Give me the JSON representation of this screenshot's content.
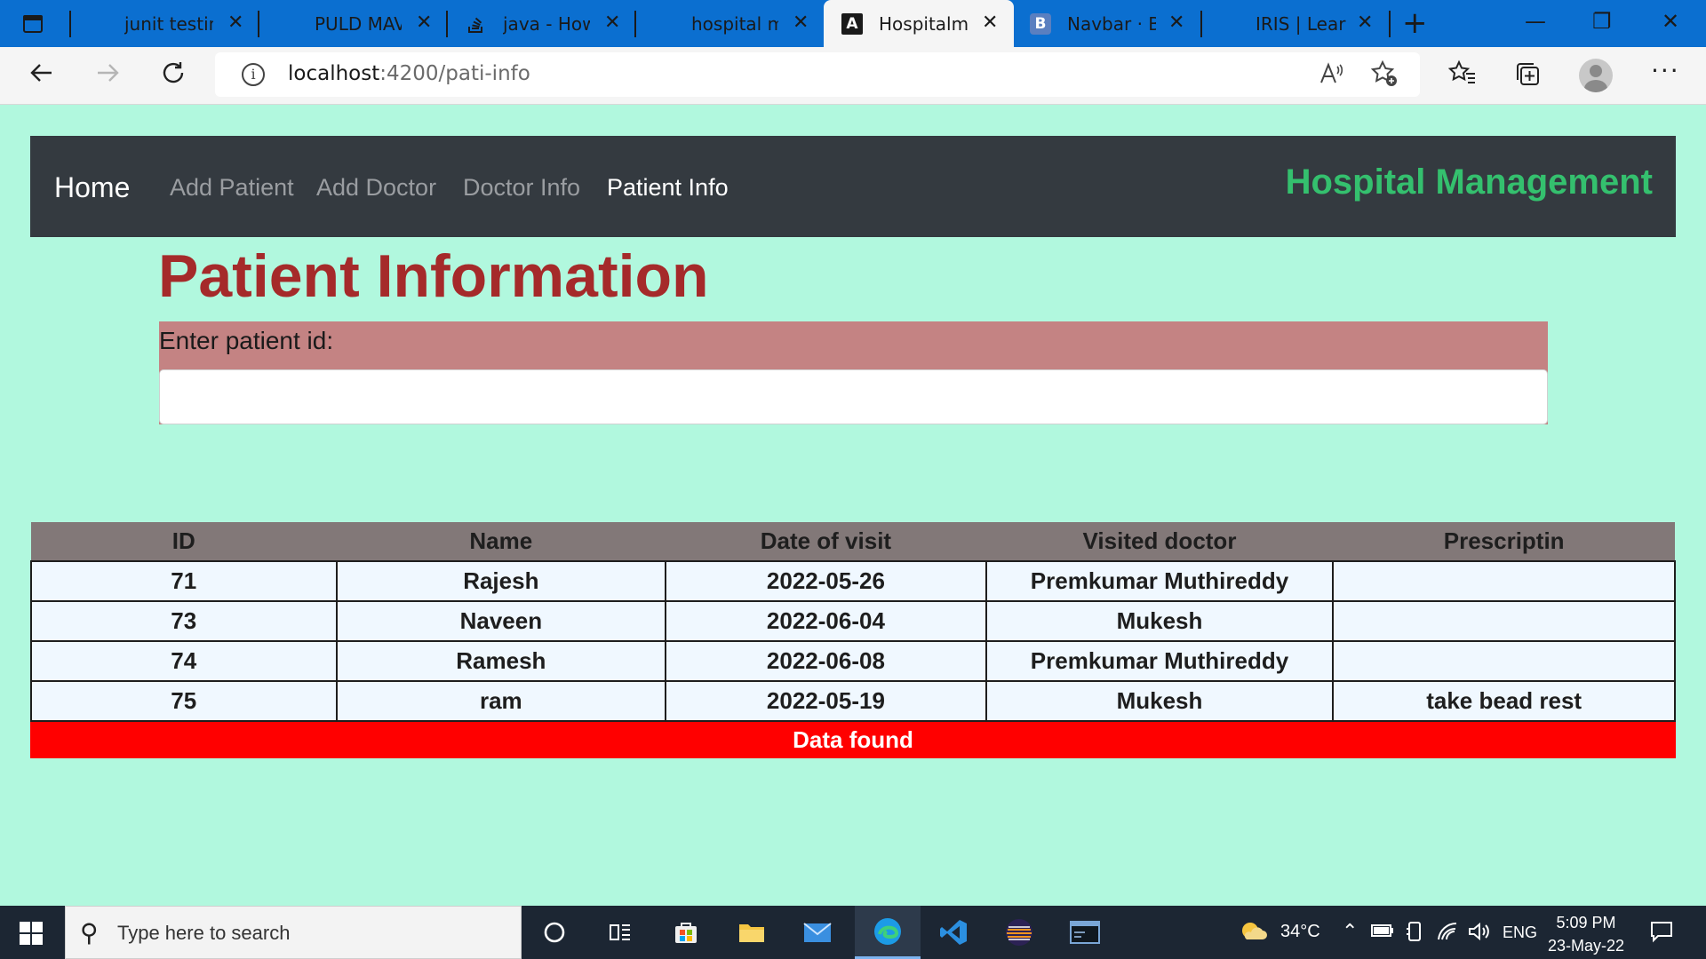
{
  "browser": {
    "tabs": [
      {
        "title": "junit testing",
        "close": "✕"
      },
      {
        "title": "PULD MAVEN",
        "close": "✕"
      },
      {
        "title": "java - How",
        "close": "✕"
      },
      {
        "title": "hospital ma",
        "close": "✕"
      },
      {
        "title": "Hospitalma",
        "close": "✕",
        "active": true
      },
      {
        "title": "Navbar · Bo",
        "close": "✕"
      },
      {
        "title": "IRIS | Learn",
        "close": "✕"
      }
    ],
    "new_tab": "+",
    "window": {
      "minimize": "—",
      "restore": "❐",
      "close": "✕"
    },
    "address": {
      "host": "localhost",
      "path": ":4200/pati-info"
    },
    "tab_icon_letters": {
      "angular": "A",
      "bootstrap": "B"
    }
  },
  "app": {
    "brand": "Home",
    "nav": [
      "Add Patient",
      "Add Doctor",
      "Doctor Info",
      "Patient Info"
    ],
    "title": "Hospital Management",
    "brand_color": "#34c06e"
  },
  "page": {
    "heading": "Patient Information",
    "label": "Enter patient id:",
    "input_value": ""
  },
  "table": {
    "headers": [
      "ID",
      "Name",
      "Date of visit",
      "Visited doctor",
      "Prescriptin"
    ],
    "rows": [
      [
        "71",
        "Rajesh",
        "2022-05-26",
        "Premkumar Muthireddy",
        ""
      ],
      [
        "73",
        "Naveen",
        "2022-06-04",
        "Mukesh",
        ""
      ],
      [
        "74",
        "Ramesh",
        "2022-06-08",
        "Premkumar Muthireddy",
        ""
      ],
      [
        "75",
        "ram",
        "2022-05-19",
        "Mukesh",
        "take bead rest"
      ]
    ],
    "status": "Data found",
    "status_color": "#ff0000"
  },
  "taskbar": {
    "search_placeholder": "Type here to search",
    "temperature": "34°C",
    "language": "ENG",
    "time": "5:09 PM",
    "date": "23-May-22"
  }
}
